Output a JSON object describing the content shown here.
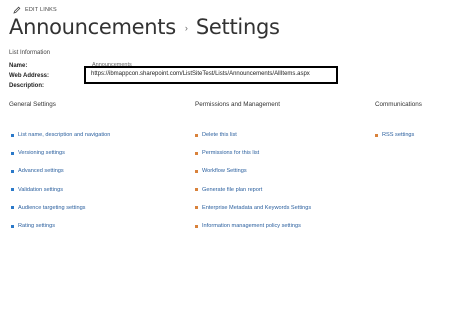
{
  "header": {
    "edit_links": "EDIT LINKS",
    "breadcrumb_list": "Announcements",
    "breadcrumb_separator": "›",
    "breadcrumb_page": "Settings"
  },
  "list_information": {
    "heading": "List Information",
    "name_label": "Name:",
    "name_value": "Announcements",
    "web_address_label": "Web Address:",
    "web_address_value": "https://ibmappcon.sharepoint.com/ListSiteTest/Lists/Announcements/AllItems.aspx",
    "description_label": "Description:"
  },
  "general_settings": {
    "heading": "General Settings",
    "items": [
      "List name, description and navigation",
      "Versioning settings",
      "Advanced settings",
      "Validation settings",
      "Audience targeting settings",
      "Rating settings"
    ]
  },
  "permissions": {
    "heading": "Permissions and Management",
    "items": [
      "Delete this list",
      "Permissions for this list",
      "Workflow Settings",
      "Generate file plan report",
      "Enterprise Metadata and Keywords Settings",
      "Information management policy settings"
    ]
  },
  "communications": {
    "heading": "Communications",
    "items": [
      "RSS settings"
    ]
  },
  "colors": {
    "link": "#2a5f9e",
    "bullet_blue": "#2b79c9",
    "bullet_orange": "#d9823b",
    "highlight_box": "#000000"
  }
}
